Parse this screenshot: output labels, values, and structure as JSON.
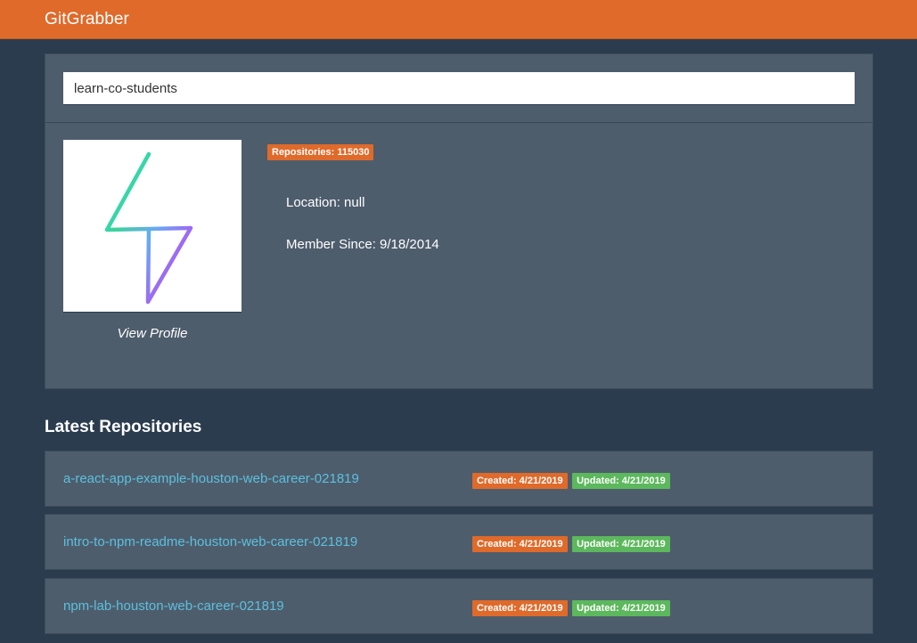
{
  "header": {
    "brand": "GitGrabber",
    "color": "#df6a2a"
  },
  "search": {
    "value": "learn-co-students"
  },
  "profile": {
    "avatar_icon": "lightning-bolt-logo",
    "view_profile_label": "View Profile",
    "repositories_badge": "Repositories: 115030",
    "location": "Location: null",
    "member_since": "Member Since: 9/18/2014"
  },
  "latest": {
    "title": "Latest Repositories",
    "repos": [
      {
        "name": "a-react-app-example-houston-web-career-021819",
        "created": "Created: 4/21/2019",
        "updated": "Updated: 4/21/2019"
      },
      {
        "name": "intro-to-npm-readme-houston-web-career-021819",
        "created": "Created: 4/21/2019",
        "updated": "Updated: 4/21/2019"
      },
      {
        "name": "npm-lab-houston-web-career-021819",
        "created": "Created: 4/21/2019",
        "updated": "Updated: 4/21/2019"
      }
    ]
  },
  "colors": {
    "background": "#2b3c4e",
    "panel": "#4e5d6c",
    "link": "#5bc0de",
    "badge_created": "#df6a2a",
    "badge_updated": "#5cb85c"
  }
}
